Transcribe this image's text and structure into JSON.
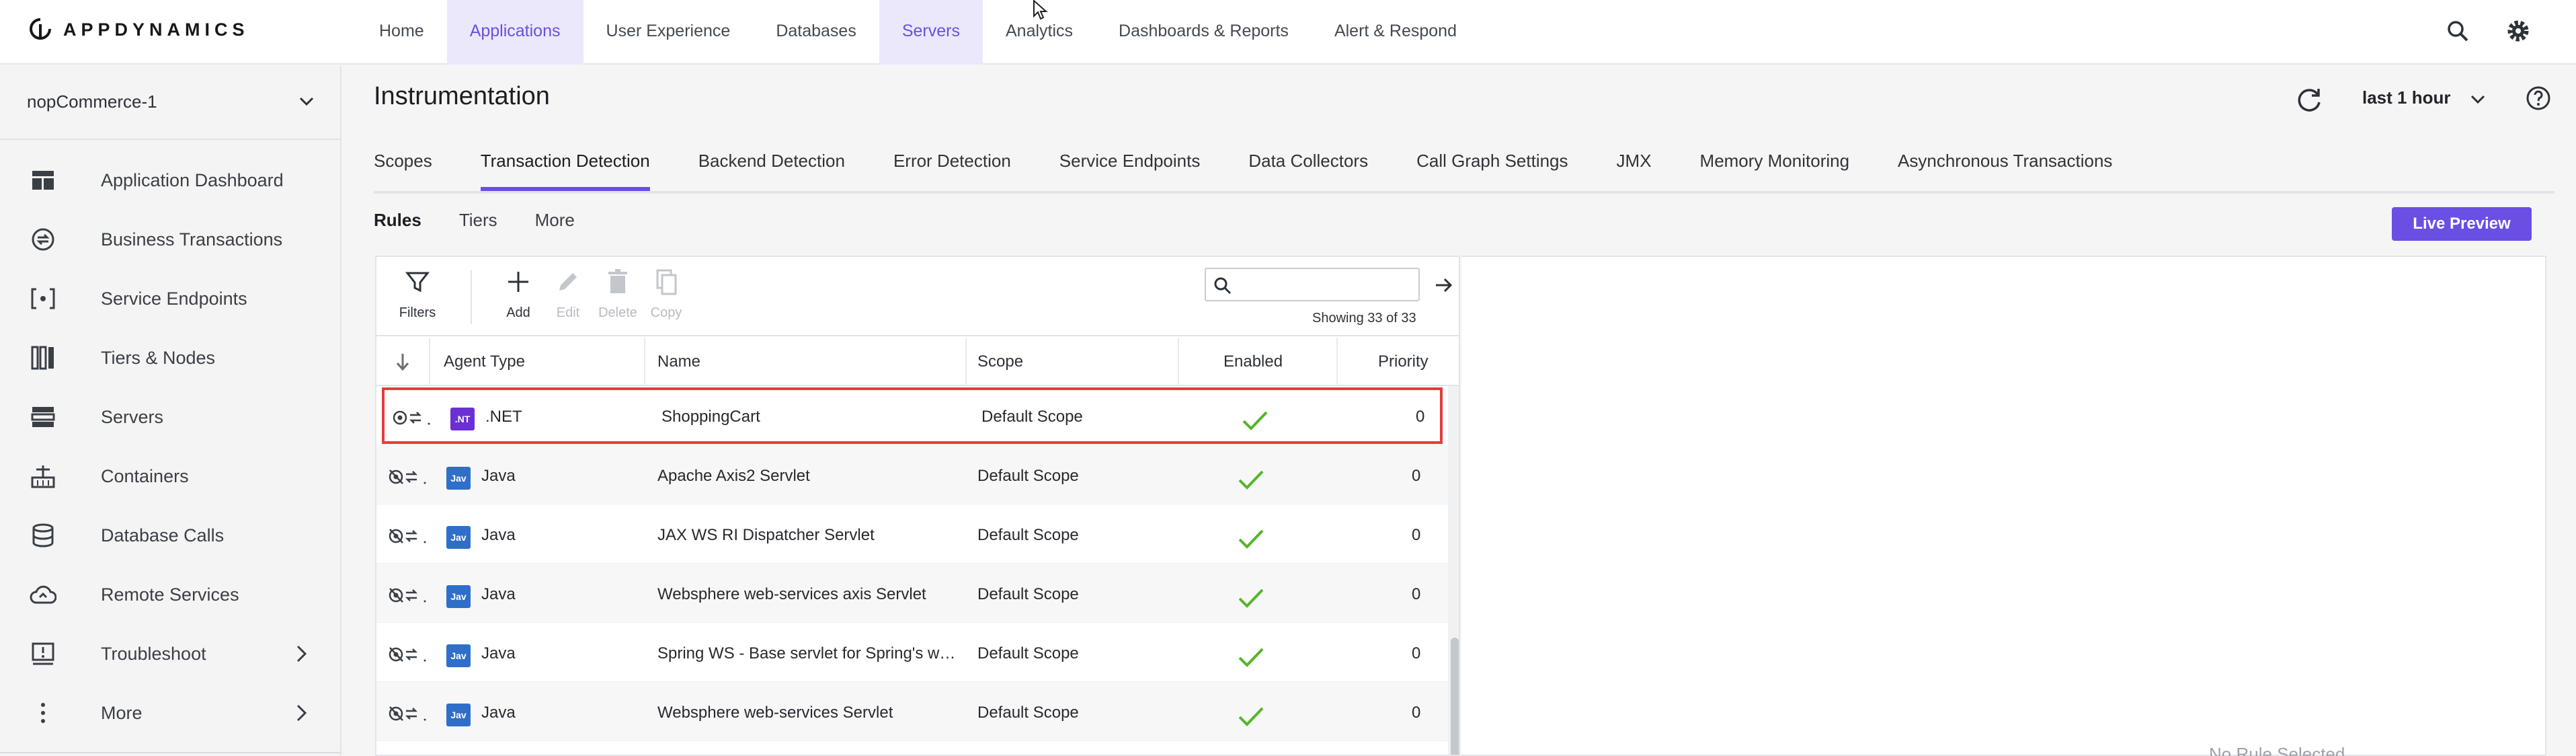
{
  "brand": {
    "name": "APPDYNAMICS",
    "accent": "#6b4fe3"
  },
  "topnav": {
    "items": [
      {
        "label": "Home",
        "active": false
      },
      {
        "label": "Applications",
        "active": true
      },
      {
        "label": "User Experience",
        "active": false
      },
      {
        "label": "Databases",
        "active": false
      },
      {
        "label": "Servers",
        "active": true
      },
      {
        "label": "Analytics",
        "active": false
      },
      {
        "label": "Dashboards & Reports",
        "active": false
      },
      {
        "label": "Alert & Respond",
        "active": false
      }
    ],
    "icons": [
      "search-icon",
      "gear-icon"
    ]
  },
  "sidebar": {
    "app_name": "nopCommerce-1",
    "items": [
      {
        "label": "Application Dashboard",
        "icon": "dashboard-icon"
      },
      {
        "label": "Business Transactions",
        "icon": "business-transactions-icon"
      },
      {
        "label": "Service Endpoints",
        "icon": "service-endpoints-icon"
      },
      {
        "label": "Tiers & Nodes",
        "icon": "tiers-nodes-icon"
      },
      {
        "label": "Servers",
        "icon": "servers-icon"
      },
      {
        "label": "Containers",
        "icon": "containers-icon"
      },
      {
        "label": "Database Calls",
        "icon": "database-icon"
      },
      {
        "label": "Remote Services",
        "icon": "cloud-icon"
      },
      {
        "label": "Troubleshoot",
        "icon": "troubleshoot-icon"
      },
      {
        "label": "More",
        "icon": "more-icon"
      }
    ]
  },
  "page": {
    "title": "Instrumentation",
    "time_range": "last 1 hour",
    "tabs": [
      {
        "label": "Scopes",
        "active": false
      },
      {
        "label": "Transaction Detection",
        "active": true
      },
      {
        "label": "Backend Detection",
        "active": false
      },
      {
        "label": "Error Detection",
        "active": false
      },
      {
        "label": "Service Endpoints",
        "active": false
      },
      {
        "label": "Data Collectors",
        "active": false
      },
      {
        "label": "Call Graph Settings",
        "active": false
      },
      {
        "label": "JMX",
        "active": false
      },
      {
        "label": "Memory Monitoring",
        "active": false
      },
      {
        "label": "Asynchronous Transactions",
        "active": false
      }
    ],
    "subtabs": [
      {
        "label": "Rules",
        "active": true
      },
      {
        "label": "Tiers",
        "active": false
      },
      {
        "label": "More",
        "active": false
      }
    ],
    "live_preview_label": "Live Preview"
  },
  "toolbar": {
    "filters_label": "Filters",
    "add_label": "Add",
    "edit_label": "Edit",
    "delete_label": "Delete",
    "copy_label": "Copy",
    "search_value": "",
    "showing_text": "Showing 33 of 33"
  },
  "table": {
    "headers": {
      "agent_type": "Agent Type",
      "name": "Name",
      "scope": "Scope",
      "enabled": "Enabled",
      "priority": "Priority"
    },
    "rows": [
      {
        "badge": ".NT",
        "badge_color": "#6b2fd6",
        "agent_type": ".NET",
        "name": "ShoppingCart",
        "scope": "Default Scope",
        "enabled": true,
        "priority": "0",
        "highlight": true
      },
      {
        "badge": "Jav",
        "badge_color": "#2f6fc9",
        "agent_type": "Java",
        "name": "Apache Axis2 Servlet",
        "scope": "Default Scope",
        "enabled": true,
        "priority": "0",
        "highlight": false
      },
      {
        "badge": "Jav",
        "badge_color": "#2f6fc9",
        "agent_type": "Java",
        "name": "JAX WS RI Dispatcher Servlet",
        "scope": "Default Scope",
        "enabled": true,
        "priority": "0",
        "highlight": false
      },
      {
        "badge": "Jav",
        "badge_color": "#2f6fc9",
        "agent_type": "Java",
        "name": "Websphere web-services axis Servlet",
        "scope": "Default Scope",
        "enabled": true,
        "priority": "0",
        "highlight": false
      },
      {
        "badge": "Jav",
        "badge_color": "#2f6fc9",
        "agent_type": "Java",
        "name": "Spring WS - Base servlet for Spring's we...",
        "scope": "Default Scope",
        "enabled": true,
        "priority": "0",
        "highlight": false
      },
      {
        "badge": "Jav",
        "badge_color": "#2f6fc9",
        "agent_type": "Java",
        "name": "Websphere web-services Servlet",
        "scope": "Default Scope",
        "enabled": true,
        "priority": "0",
        "highlight": false
      }
    ]
  },
  "preview": {
    "empty_text": "No Rule Selected"
  }
}
